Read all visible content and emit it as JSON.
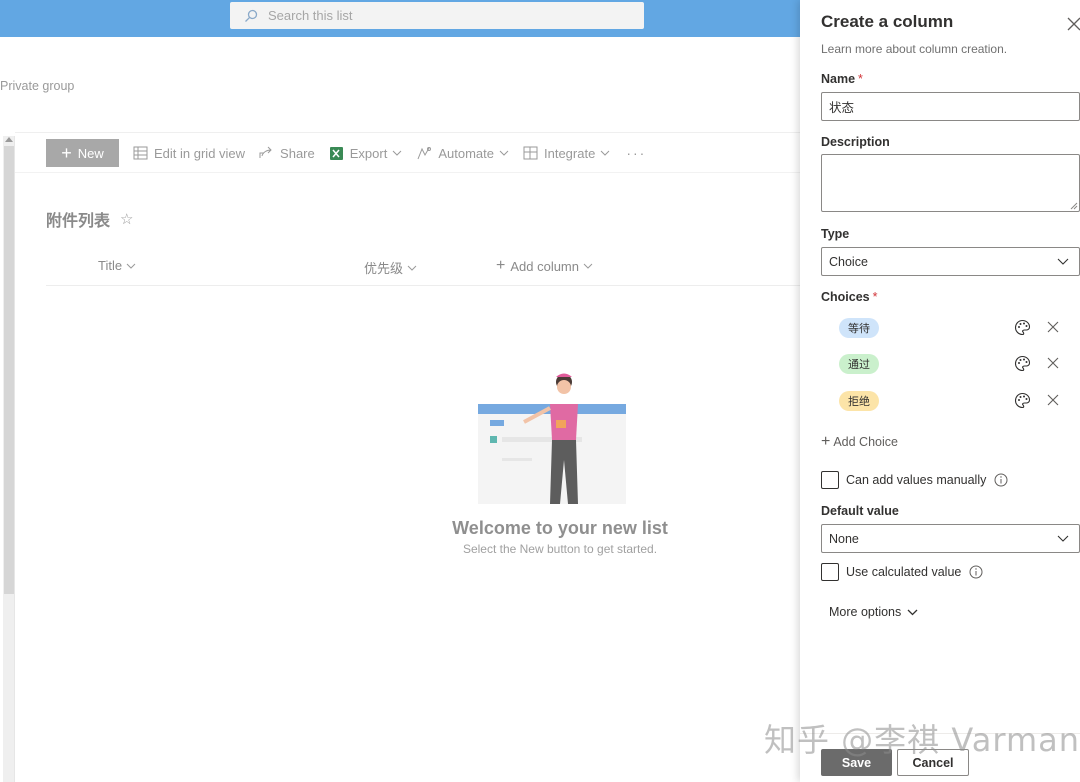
{
  "header": {
    "search_placeholder": "Search this list"
  },
  "site": {
    "group_label": "Private group"
  },
  "command_bar": {
    "new_label": "New",
    "edit_grid_label": "Edit in grid view",
    "share_label": "Share",
    "export_label": "Export",
    "automate_label": "Automate",
    "integrate_label": "Integrate",
    "more_label": "···"
  },
  "list": {
    "title": "附件列表",
    "columns": [
      "Title",
      "优先级",
      "Add column"
    ],
    "welcome_title": "Welcome to your new list",
    "welcome_sub": "Select the New button to get started."
  },
  "panel": {
    "title": "Create a column",
    "learn_more": "Learn more about column creation.",
    "name_label": "Name",
    "name_value": "状态",
    "description_label": "Description",
    "type_label": "Type",
    "type_value": "Choice",
    "choices_label": "Choices",
    "choices": [
      {
        "label": "等待",
        "color": "#cfe4fa"
      },
      {
        "label": "通过",
        "color": "#caf0cc"
      },
      {
        "label": "拒绝",
        "color": "#fce4a8"
      }
    ],
    "add_choice_label": "Add Choice",
    "manual_values_label": "Can add values manually",
    "default_value_label": "Default value",
    "default_value": "None",
    "calculated_label": "Use calculated value",
    "more_options_label": "More options",
    "save_label": "Save",
    "cancel_label": "Cancel"
  },
  "colors": {
    "topbar": "#62a7e3",
    "required": "#d13438",
    "save_button": "#6b6b6b"
  },
  "watermark": "知乎 @李祺 Varman"
}
